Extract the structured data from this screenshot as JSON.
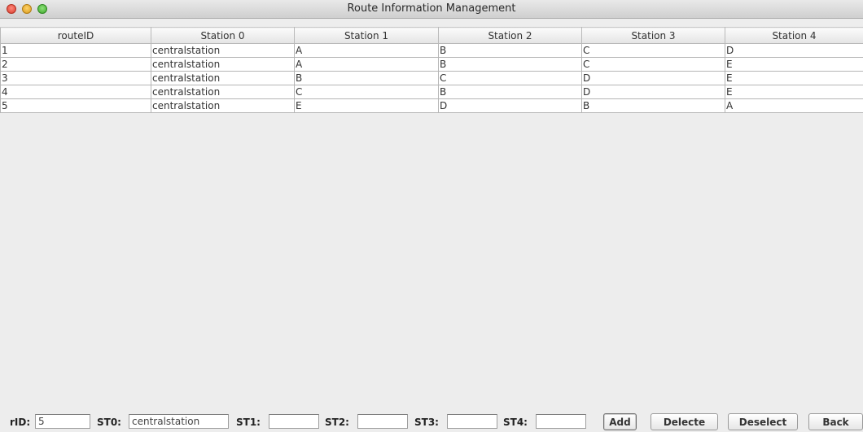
{
  "window": {
    "title": "Route Information Management"
  },
  "table": {
    "columns": [
      "routeID",
      "Station 0",
      "Station 1",
      "Station 2",
      "Station 3",
      "Station 4"
    ],
    "rows": [
      [
        "1",
        "centralstation",
        "A",
        "B",
        "C",
        "D"
      ],
      [
        "2",
        "centralstation",
        "A",
        "B",
        "C",
        "E"
      ],
      [
        "3",
        "centralstation",
        "B",
        "C",
        "D",
        "E"
      ],
      [
        "4",
        "centralstation",
        "C",
        "B",
        "D",
        "E"
      ],
      [
        "5",
        "centralstation",
        "E",
        "D",
        "B",
        "A"
      ]
    ]
  },
  "form": {
    "rid_label": "rID:",
    "rid_value": "5",
    "st0_label": "ST0:",
    "st0_value": "centralstation",
    "st1_label": "ST1:",
    "st1_value": "",
    "st2_label": "ST2:",
    "st2_value": "",
    "st3_label": "ST3:",
    "st3_value": "",
    "st4_label": "ST4:",
    "st4_value": ""
  },
  "buttons": {
    "add": "Add",
    "delete": "Delecte",
    "deselect": "Deselect",
    "back": "Back"
  }
}
